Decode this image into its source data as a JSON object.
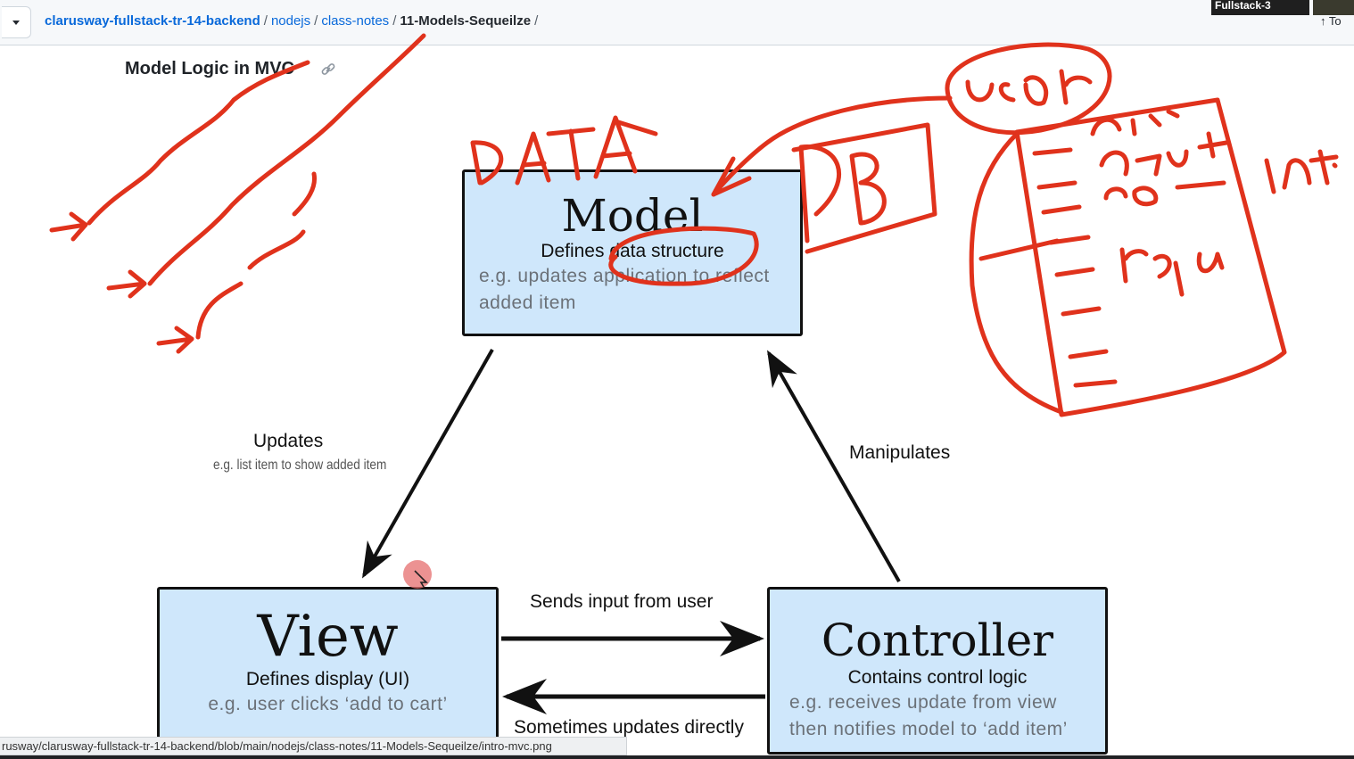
{
  "breadcrumb": {
    "repo": "clarusway-fullstack-tr-14-backend",
    "items": [
      "nodejs",
      "class-notes"
    ],
    "current": "11-Models-Sequeilze",
    "separator": "/"
  },
  "overlay": {
    "video_label": "Fullstack-3",
    "top_link": "↑ To"
  },
  "page": {
    "heading": "Model Logic in MVC"
  },
  "diagram": {
    "model": {
      "title": "Model",
      "subtitle": "Defines data structure",
      "example": "e.g. updates application to reflect added item"
    },
    "view": {
      "title": "View",
      "subtitle": "Defines display (UI)",
      "example": "e.g. user clicks ‘add to cart’"
    },
    "controller": {
      "title": "Controller",
      "subtitle": "Contains control logic",
      "example": "e.g. receives update from view then notifies model to ‘add item’"
    },
    "edges": {
      "updates": "Updates",
      "updates_example": "e.g. list item to show added item",
      "manipulates": "Manipulates",
      "sends_input": "Sends input from user",
      "sometimes_updates": "Sometimes updates directly"
    }
  },
  "annotation": {
    "color": "#e0321c"
  },
  "statusbar": {
    "url": "rusway/clarusway-fullstack-tr-14-backend/blob/main/nodejs/class-notes/11-Models-Sequeilze/intro-mvc.png"
  }
}
